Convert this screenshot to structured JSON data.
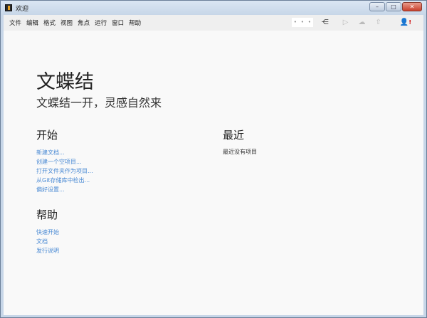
{
  "window": {
    "title": "欢迎",
    "minimize": "–",
    "maximize": "□",
    "close": "✕"
  },
  "menu": [
    "文件",
    "编辑",
    "格式",
    "视图",
    "焦点",
    "运行",
    "窗口",
    "帮助"
  ],
  "toolbar": {
    "dots": [
      "•",
      "•",
      "•"
    ],
    "icons": [
      "branch-icon",
      "play-icon",
      "cloud-upload-icon",
      "share-icon",
      "user-alert-icon"
    ]
  },
  "welcome": {
    "title": "文蝶结",
    "subtitle": "文蝶结一开，灵感自然来"
  },
  "start": {
    "heading": "开始",
    "items": [
      "新建文档...",
      "创建一个空项目...",
      "打开文件夹作为项目...",
      "从Git存储库中检出...",
      "偏好设置..."
    ]
  },
  "recent": {
    "heading": "最近",
    "empty": "最近没有项目"
  },
  "help": {
    "heading": "帮助",
    "items": [
      "快速开始",
      "文档",
      "发行说明"
    ]
  },
  "colors": {
    "link": "#4a8ad4"
  }
}
